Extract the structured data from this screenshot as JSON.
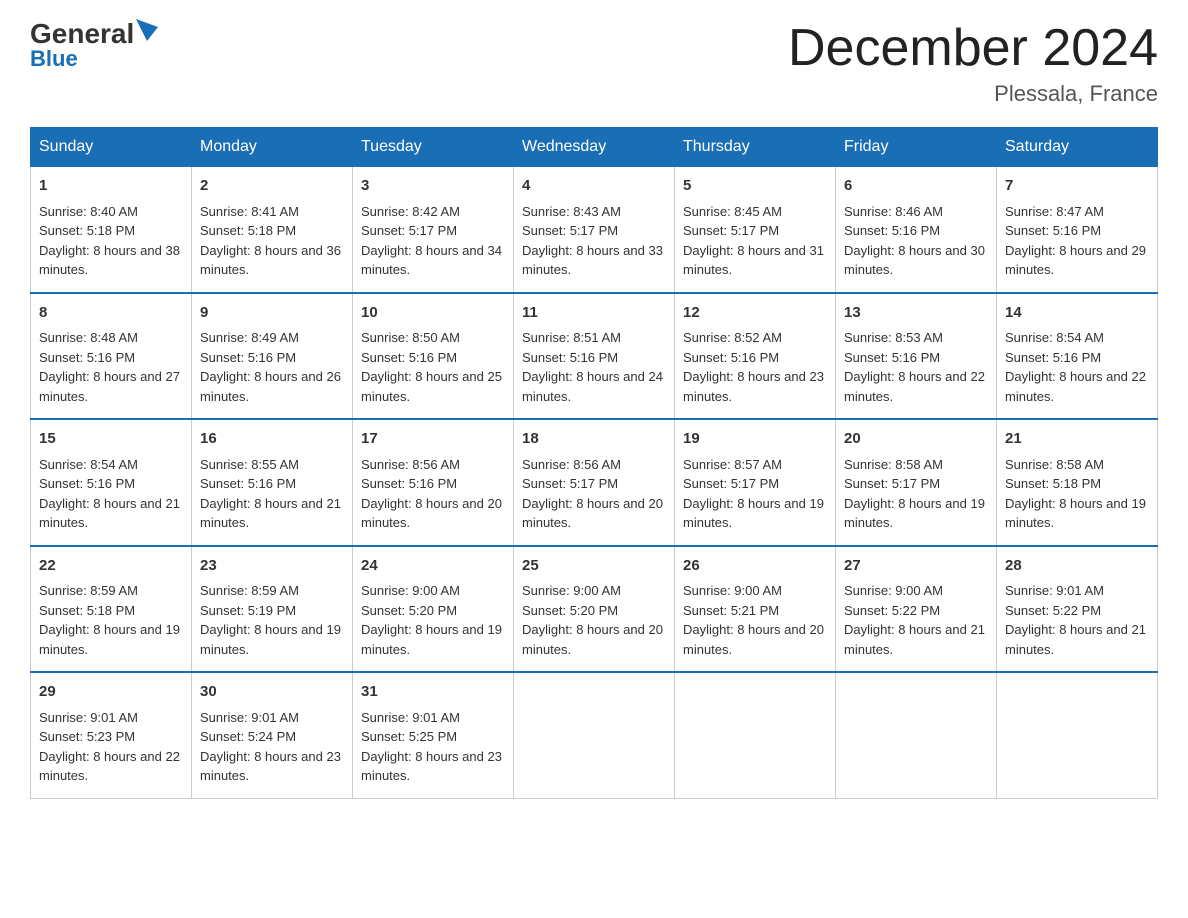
{
  "logo": {
    "text1": "General",
    "text2": "Blue"
  },
  "title": "December 2024",
  "location": "Plessala, France",
  "days_of_week": [
    "Sunday",
    "Monday",
    "Tuesday",
    "Wednesday",
    "Thursday",
    "Friday",
    "Saturday"
  ],
  "weeks": [
    [
      {
        "date": "1",
        "sunrise": "8:40 AM",
        "sunset": "5:18 PM",
        "daylight": "8 hours and 38 minutes."
      },
      {
        "date": "2",
        "sunrise": "8:41 AM",
        "sunset": "5:18 PM",
        "daylight": "8 hours and 36 minutes."
      },
      {
        "date": "3",
        "sunrise": "8:42 AM",
        "sunset": "5:17 PM",
        "daylight": "8 hours and 34 minutes."
      },
      {
        "date": "4",
        "sunrise": "8:43 AM",
        "sunset": "5:17 PM",
        "daylight": "8 hours and 33 minutes."
      },
      {
        "date": "5",
        "sunrise": "8:45 AM",
        "sunset": "5:17 PM",
        "daylight": "8 hours and 31 minutes."
      },
      {
        "date": "6",
        "sunrise": "8:46 AM",
        "sunset": "5:16 PM",
        "daylight": "8 hours and 30 minutes."
      },
      {
        "date": "7",
        "sunrise": "8:47 AM",
        "sunset": "5:16 PM",
        "daylight": "8 hours and 29 minutes."
      }
    ],
    [
      {
        "date": "8",
        "sunrise": "8:48 AM",
        "sunset": "5:16 PM",
        "daylight": "8 hours and 27 minutes."
      },
      {
        "date": "9",
        "sunrise": "8:49 AM",
        "sunset": "5:16 PM",
        "daylight": "8 hours and 26 minutes."
      },
      {
        "date": "10",
        "sunrise": "8:50 AM",
        "sunset": "5:16 PM",
        "daylight": "8 hours and 25 minutes."
      },
      {
        "date": "11",
        "sunrise": "8:51 AM",
        "sunset": "5:16 PM",
        "daylight": "8 hours and 24 minutes."
      },
      {
        "date": "12",
        "sunrise": "8:52 AM",
        "sunset": "5:16 PM",
        "daylight": "8 hours and 23 minutes."
      },
      {
        "date": "13",
        "sunrise": "8:53 AM",
        "sunset": "5:16 PM",
        "daylight": "8 hours and 22 minutes."
      },
      {
        "date": "14",
        "sunrise": "8:54 AM",
        "sunset": "5:16 PM",
        "daylight": "8 hours and 22 minutes."
      }
    ],
    [
      {
        "date": "15",
        "sunrise": "8:54 AM",
        "sunset": "5:16 PM",
        "daylight": "8 hours and 21 minutes."
      },
      {
        "date": "16",
        "sunrise": "8:55 AM",
        "sunset": "5:16 PM",
        "daylight": "8 hours and 21 minutes."
      },
      {
        "date": "17",
        "sunrise": "8:56 AM",
        "sunset": "5:16 PM",
        "daylight": "8 hours and 20 minutes."
      },
      {
        "date": "18",
        "sunrise": "8:56 AM",
        "sunset": "5:17 PM",
        "daylight": "8 hours and 20 minutes."
      },
      {
        "date": "19",
        "sunrise": "8:57 AM",
        "sunset": "5:17 PM",
        "daylight": "8 hours and 19 minutes."
      },
      {
        "date": "20",
        "sunrise": "8:58 AM",
        "sunset": "5:17 PM",
        "daylight": "8 hours and 19 minutes."
      },
      {
        "date": "21",
        "sunrise": "8:58 AM",
        "sunset": "5:18 PM",
        "daylight": "8 hours and 19 minutes."
      }
    ],
    [
      {
        "date": "22",
        "sunrise": "8:59 AM",
        "sunset": "5:18 PM",
        "daylight": "8 hours and 19 minutes."
      },
      {
        "date": "23",
        "sunrise": "8:59 AM",
        "sunset": "5:19 PM",
        "daylight": "8 hours and 19 minutes."
      },
      {
        "date": "24",
        "sunrise": "9:00 AM",
        "sunset": "5:20 PM",
        "daylight": "8 hours and 19 minutes."
      },
      {
        "date": "25",
        "sunrise": "9:00 AM",
        "sunset": "5:20 PM",
        "daylight": "8 hours and 20 minutes."
      },
      {
        "date": "26",
        "sunrise": "9:00 AM",
        "sunset": "5:21 PM",
        "daylight": "8 hours and 20 minutes."
      },
      {
        "date": "27",
        "sunrise": "9:00 AM",
        "sunset": "5:22 PM",
        "daylight": "8 hours and 21 minutes."
      },
      {
        "date": "28",
        "sunrise": "9:01 AM",
        "sunset": "5:22 PM",
        "daylight": "8 hours and 21 minutes."
      }
    ],
    [
      {
        "date": "29",
        "sunrise": "9:01 AM",
        "sunset": "5:23 PM",
        "daylight": "8 hours and 22 minutes."
      },
      {
        "date": "30",
        "sunrise": "9:01 AM",
        "sunset": "5:24 PM",
        "daylight": "8 hours and 23 minutes."
      },
      {
        "date": "31",
        "sunrise": "9:01 AM",
        "sunset": "5:25 PM",
        "daylight": "8 hours and 23 minutes."
      },
      null,
      null,
      null,
      null
    ]
  ],
  "labels": {
    "sunrise": "Sunrise:",
    "sunset": "Sunset:",
    "daylight": "Daylight:"
  }
}
